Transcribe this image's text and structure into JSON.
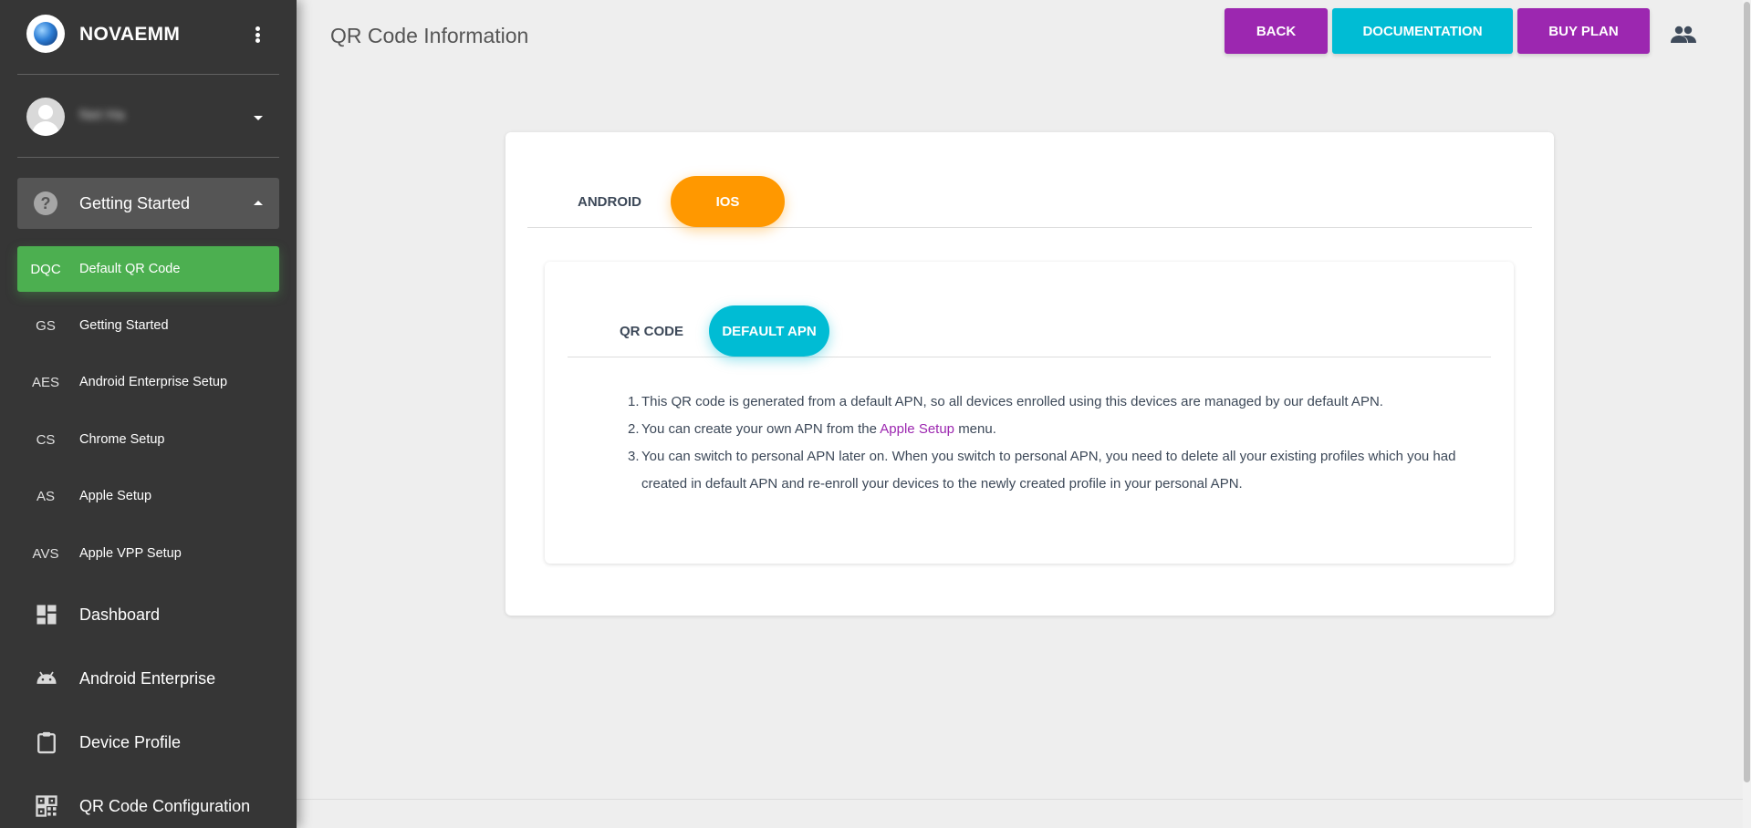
{
  "brand": {
    "name": "NOVAEMM"
  },
  "user": {
    "name": "Net Ha"
  },
  "sidebar": {
    "group": {
      "label": "Getting Started"
    },
    "sub_items": [
      {
        "abbr": "DQC",
        "label": "Default QR Code",
        "active": true
      },
      {
        "abbr": "GS",
        "label": "Getting Started"
      },
      {
        "abbr": "AES",
        "label": "Android Enterprise Setup"
      },
      {
        "abbr": "CS",
        "label": "Chrome Setup"
      },
      {
        "abbr": "AS",
        "label": "Apple Setup"
      },
      {
        "abbr": "AVS",
        "label": "Apple VPP Setup"
      }
    ],
    "main_items": [
      {
        "label": "Dashboard",
        "icon": "dashboard-icon"
      },
      {
        "label": "Android Enterprise",
        "icon": "android-icon"
      },
      {
        "label": "Device Profile",
        "icon": "clipboard-icon"
      },
      {
        "label": "QR Code Configuration",
        "icon": "qr-code-icon"
      }
    ]
  },
  "header": {
    "title": "QR Code Information",
    "back": "BACK",
    "documentation": "DOCUMENTATION",
    "buy_plan": "BUY PLAN"
  },
  "platform_tabs": {
    "android": "ANDROID",
    "ios": "IOS",
    "active": "ios"
  },
  "ios_tabs": {
    "qr_code": "QR CODE",
    "default_apn": "DEFAULT APN",
    "active": "default_apn"
  },
  "notes": {
    "n1": "1.",
    "t1": "This QR code is generated from a default APN, so all devices enrolled using this devices are managed by our default APN.",
    "n2": "2.",
    "t2_before": "You can create your own APN from the",
    "t2_link": "Apple Setup",
    "t2_after": "menu.",
    "n3": "3.",
    "t3": "You can switch to personal APN later on. When you switch to personal APN, you need to delete all your existing profiles which you had created in default APN and re-enroll your devices to the newly created profile in your personal APN."
  },
  "colors": {
    "sidebar": "#363636",
    "active_item": "#4caf50",
    "purple": "#9c27b0",
    "cyan": "#00bcd4",
    "orange": "#ff9800"
  }
}
